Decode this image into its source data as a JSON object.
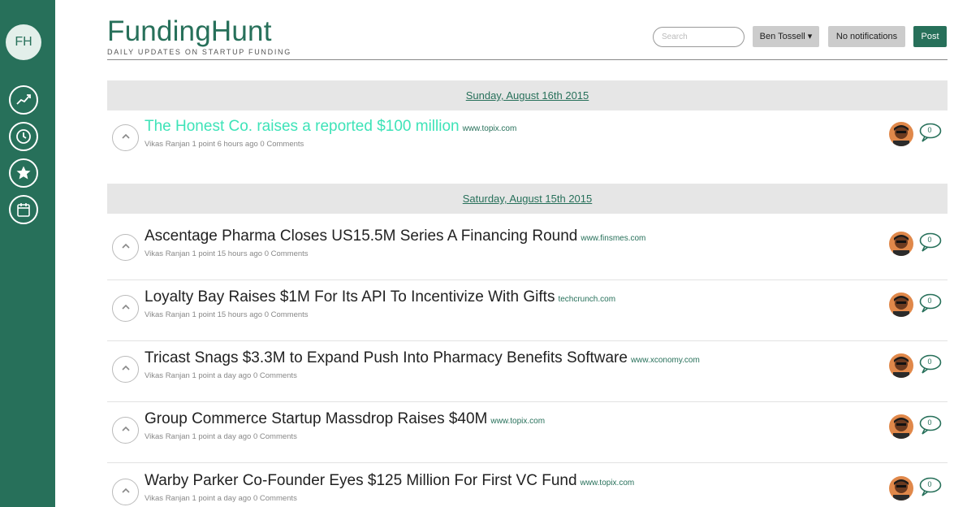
{
  "app": {
    "logo_text": "FH",
    "brand_title": "FundingHunt",
    "brand_tagline": "DAILY UPDATES ON STARTUP FUNDING"
  },
  "sidebar": {
    "items": [
      {
        "icon": "chart-icon"
      },
      {
        "icon": "clock-icon"
      },
      {
        "icon": "star-icon"
      },
      {
        "icon": "calendar-icon"
      }
    ]
  },
  "header": {
    "search_placeholder": "Search",
    "user_label": "Ben Tossell ▾",
    "notifications_label": "No notifications",
    "post_label": "Post"
  },
  "days": [
    {
      "date": "Sunday, August 16th 2015",
      "posts": [
        {
          "title": "The Honest Co. raises a reported $100 million",
          "domain": "www.topix.com",
          "meta": "Vikas Ranjan 1 point 6 hours ago 0 Comments",
          "comments": "0"
        }
      ]
    },
    {
      "date": "Saturday, August 15th 2015",
      "posts": [
        {
          "title": "Ascentage Pharma Closes US15.5M Series A Financing Round",
          "domain": "www.finsmes.com",
          "meta": "Vikas Ranjan 1 point 15 hours ago 0 Comments",
          "comments": "0"
        },
        {
          "title": "Loyalty Bay Raises $1M For Its API To Incentivize With Gifts",
          "domain": "techcrunch.com",
          "meta": "Vikas Ranjan 1 point 15 hours ago 0 Comments",
          "comments": "0"
        },
        {
          "title": "Tricast Snags $3.3M to Expand Push Into Pharmacy Benefits Software",
          "domain": "www.xconomy.com",
          "meta": "Vikas Ranjan 1 point a day ago 0 Comments",
          "comments": "0"
        },
        {
          "title": "Group Commerce Startup Massdrop Raises $40M",
          "domain": "www.topix.com",
          "meta": "Vikas Ranjan 1 point a day ago 0 Comments",
          "comments": "0"
        },
        {
          "title": "Warby Parker Co-Founder Eyes $125 Million For First VC Fund",
          "domain": "www.topix.com",
          "meta": "Vikas Ranjan 1 point a day ago 0 Comments",
          "comments": "0"
        }
      ]
    }
  ],
  "colors": {
    "brand": "#27705a",
    "active_title": "#3ee3b8"
  }
}
